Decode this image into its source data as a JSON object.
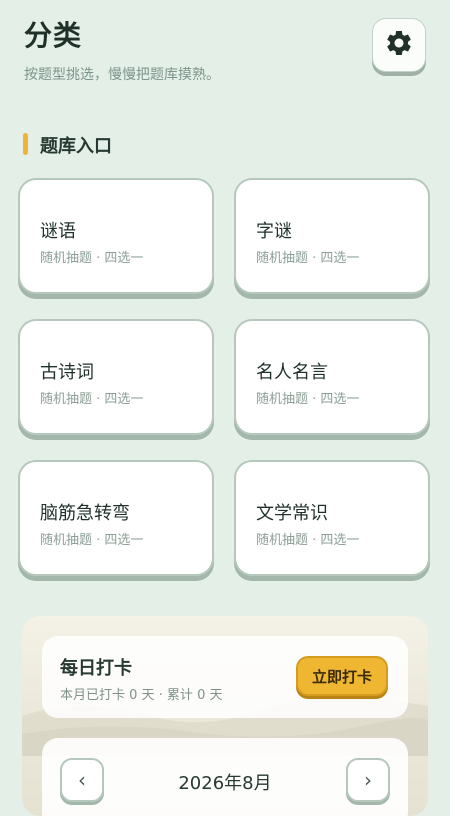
{
  "header": {
    "title": "分类",
    "subtitle": "按题型挑选，慢慢把题库摸熟。",
    "settings_icon": "gear-icon"
  },
  "section": {
    "title": "题库入口",
    "accent_color": "#ECB53A"
  },
  "categories": [
    {
      "name": "谜语",
      "desc": "随机抽题 · 四选一"
    },
    {
      "name": "字谜",
      "desc": "随机抽题 · 四选一"
    },
    {
      "name": "古诗词",
      "desc": "随机抽题 · 四选一"
    },
    {
      "name": "名人名言",
      "desc": "随机抽题 · 四选一"
    },
    {
      "name": "脑筋急转弯",
      "desc": "随机抽题 · 四选一"
    },
    {
      "name": "文学常识",
      "desc": "随机抽题 · 四选一"
    }
  ],
  "checkin": {
    "title": "每日打卡",
    "stats": "本月已打卡 0 天 · 累计 0 天",
    "button_label": "立即打卡",
    "button_color": "#EFB632"
  },
  "calendar": {
    "month_label": "2026年8月",
    "prev_label": "‹",
    "next_label": "›"
  }
}
